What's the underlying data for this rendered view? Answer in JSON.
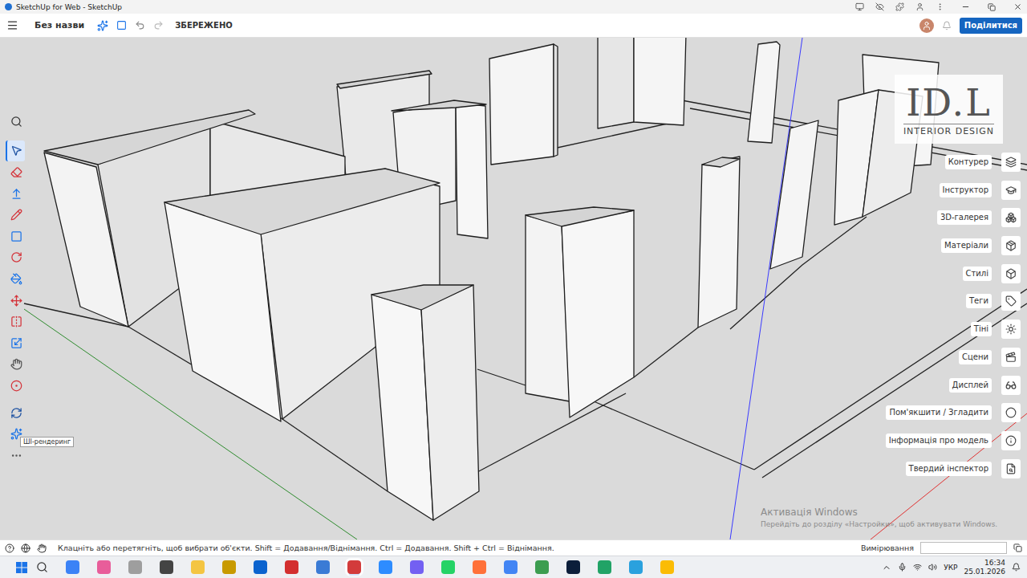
{
  "browser": {
    "title": "SketchUp for Web - SketchUp"
  },
  "header": {
    "file_name": "Без назви",
    "save_status": "ЗБЕРЕЖЕНО",
    "share_button": "Поділитися"
  },
  "toolbar": {
    "tooltip": "ШІ-рендеринг",
    "tools": [
      {
        "selected": false,
        "hovered": false
      },
      {
        "selected": true,
        "hovered": false
      },
      {
        "selected": false,
        "hovered": false
      },
      {
        "selected": false,
        "hovered": false
      },
      {
        "selected": false,
        "hovered": false
      },
      {
        "selected": false,
        "hovered": false
      },
      {
        "selected": false,
        "hovered": false
      },
      {
        "selected": false,
        "hovered": false
      },
      {
        "selected": false,
        "hovered": false
      },
      {
        "selected": false,
        "hovered": false
      },
      {
        "selected": false,
        "hovered": false
      },
      {
        "selected": false,
        "hovered": false
      },
      {
        "selected": false,
        "hovered": false
      },
      {
        "selected": false,
        "hovered": false
      },
      {
        "selected": false,
        "hovered": true
      },
      {
        "selected": false,
        "hovered": false
      }
    ]
  },
  "panel": {
    "items": [
      "Контурер",
      "Інструктор",
      "3D-галерея",
      "Матеріали",
      "Стилі",
      "Теги",
      "Тіні",
      "Сцени",
      "Дисплей",
      "Пом'якшити / Згладити",
      "Інформація про модель",
      "Твердий інспектор"
    ]
  },
  "logo": {
    "mark": "ID.L",
    "subtitle": "INTERIOR DESIGN"
  },
  "watermark": {
    "title": "Активація Windows",
    "text": "Перейдіть до розділу «Настройки», щоб активувати Windows."
  },
  "status_bar": {
    "hint": "Клацніть або перетягніть, щоб вибрати об'єкти. Shift = Додавання/Віднімання. Ctrl = Додавання. Shift + Ctrl = Віднімання.",
    "measurements_label": "Вимірювання",
    "measurements_value": ""
  },
  "taskbar": {
    "apps": [
      {
        "color": "#3b82f6",
        "selected": false
      },
      {
        "color": "#e85d9a",
        "selected": false
      },
      {
        "color": "#9e9e9e",
        "selected": false
      },
      {
        "color": "#444444",
        "selected": false
      },
      {
        "color": "#f4c542",
        "selected": false
      },
      {
        "color": "#c89a00",
        "selected": false
      },
      {
        "color": "#0b63ce",
        "selected": false
      },
      {
        "color": "#d32f2f",
        "selected": false
      },
      {
        "color": "#3a7bd5",
        "selected": false
      },
      {
        "color": "#d33b3b",
        "selected": true
      },
      {
        "color": "#2d8cff",
        "selected": false
      },
      {
        "color": "#7360f2",
        "selected": false
      },
      {
        "color": "#25d366",
        "selected": false
      },
      {
        "color": "#ff7139",
        "selected": false
      },
      {
        "color": "#4285f4",
        "selected": false
      },
      {
        "color": "#3c9d50",
        "selected": false
      },
      {
        "color": "#0b1e3a",
        "selected": false
      },
      {
        "color": "#21a366",
        "selected": false
      },
      {
        "color": "#2aa1de",
        "selected": false
      },
      {
        "color": "#fbbc05",
        "selected": false
      }
    ],
    "language": "УКР",
    "time": "16:34",
    "date": "25.01.2026"
  }
}
